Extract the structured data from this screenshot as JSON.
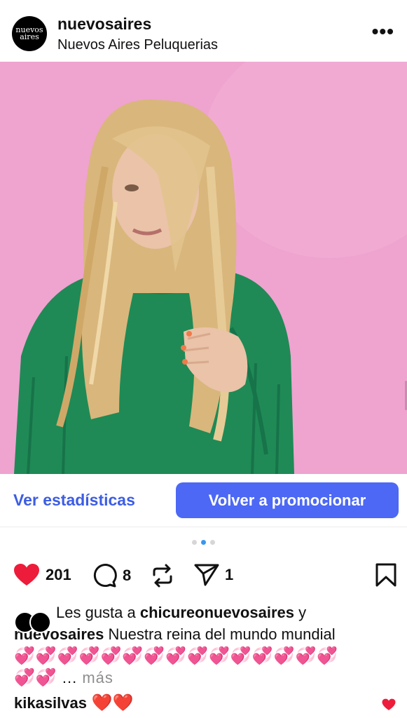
{
  "post": {
    "username": "nuevosaires",
    "subtitle": "Nuevos Aires Peluquerias",
    "avatar_text_1": "nuevos",
    "avatar_text_2": "aires"
  },
  "promo": {
    "stats_label": "Ver estadísticas",
    "promote_label": "Volver a promocionar"
  },
  "carousel": {
    "count": 3,
    "active_index": 1
  },
  "actions": {
    "likes": "201",
    "comments": "8",
    "shares": "1",
    "like_color": "#ed1c3a"
  },
  "caption": {
    "likes_prefix": "Les gusta a ",
    "liked_by": "chicureonuevosaires",
    "conjunction": " y",
    "author": "nuevosaires",
    "text": " Nuestra reina del mundo mundial",
    "hearts_line_1": "💞💞💞💞💞💞💞💞💞💞💞💞💞💞💞",
    "hearts_line_2": "💞💞",
    "ellipsis": " ... ",
    "more": "más"
  },
  "comment": {
    "user": "kikasilvas",
    "emojis": " ❤️❤️"
  },
  "icons": {
    "more": "more-options-icon",
    "like": "heart-icon",
    "comment": "comment-icon",
    "repost": "repost-icon",
    "share": "send-icon",
    "save": "bookmark-icon"
  }
}
